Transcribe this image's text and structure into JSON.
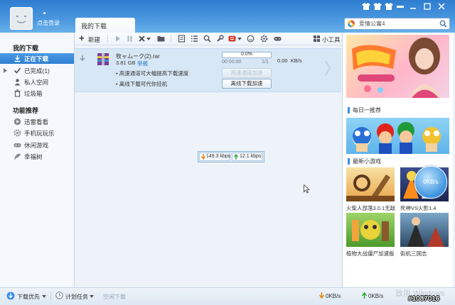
{
  "window": {
    "login_label": "点击登录",
    "tab_label": "我的下载",
    "search_value": "爱情公寓4"
  },
  "sidebar": {
    "section1_title": "我的下载",
    "items": [
      {
        "label": "正在下载",
        "icon": "download-icon"
      },
      {
        "label": "已完成(1)",
        "icon": "check-icon"
      },
      {
        "label": "私人空间",
        "icon": "person-icon"
      },
      {
        "label": "垃圾箱",
        "icon": "trash-icon"
      }
    ],
    "section2_title": "功能推荐",
    "features": [
      {
        "label": "迅雷看看",
        "icon": "play-circle-icon"
      },
      {
        "label": "手机玩玩乐",
        "icon": "gear-icon"
      },
      {
        "label": "休闲游戏",
        "icon": "gamepad-icon"
      },
      {
        "label": "幸福树",
        "icon": "tree-icon"
      }
    ]
  },
  "toolbar": {
    "new_label": "新建",
    "tools_label": "小工具"
  },
  "download": {
    "filename": "牧ャムーク(2).rar",
    "size": "3.81 GB",
    "report": "举报",
    "progress_percent": 0,
    "progress_label": "0.0%",
    "time": "00:00:00",
    "count": "1/1",
    "speed": "0.00  KB/s",
    "tip1": "• 高速通道可大幅提高下载速度",
    "tip1_button": "高速通道加速",
    "tip2": "• 离线下载可代你挂机",
    "tip2_button": "离线下载加速"
  },
  "speed_widget": {
    "down": "149.3 kbps",
    "up": "12.1 kbps"
  },
  "right_panel": {
    "daily_title": "每日一推荐",
    "games_title": "最新小游戏",
    "games": [
      {
        "caption": "火柴人部落3.0.1无敌"
      },
      {
        "caption": "死神VS火影1.4"
      },
      {
        "caption": "植物大战僵尸加速版"
      },
      {
        "caption": "街机三国志"
      }
    ],
    "speed_ball": "0KB/s"
  },
  "status_bar": {
    "priority": "下载优先",
    "schedule": "计划任务",
    "idle": "空闲下载",
    "down_speed": "0KB/s",
    "up_speed": "0KB/s"
  },
  "watermark": {
    "windows": "致用 Windows",
    "id": "#1087016"
  },
  "colors": {
    "titlebar": "#2e7ccf",
    "selected": "#3a8ce0",
    "row": "#d8e7f6",
    "link": "#1a6fc4",
    "down_arrow": "#e8870e",
    "up_arrow": "#3aa63a"
  }
}
